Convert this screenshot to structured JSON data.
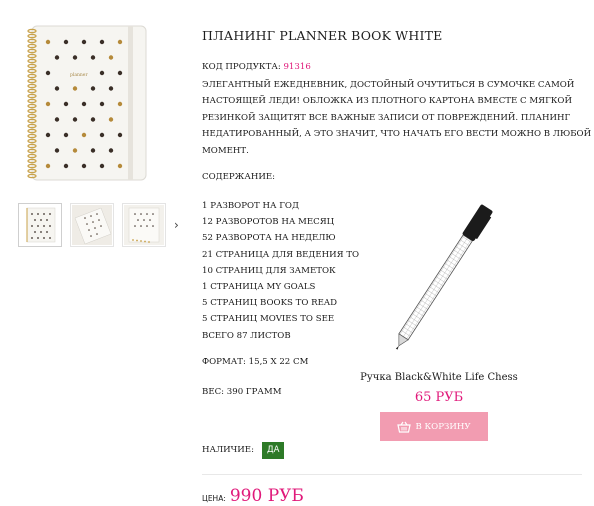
{
  "product": {
    "title": "ПЛАНИНГ PLANNER BOOK WHITE",
    "code_label": "КОД ПРОДУКТА:",
    "code_value": "91316",
    "description_lines": [
      "ЭЛЕГАНТНЫЙ ЕЖЕДНЕВНИК, ДОСТОЙНЫЙ ОЧУТИТЬСЯ В СУМОЧКЕ САМОЙ",
      "НАСТОЯЩЕЙ ЛЕДИ! ОБЛОЖКА ИЗ ПЛОТНОГО КАРТОНА ВМЕСТЕ С МЯГКОЙ",
      "РЕЗИНКОЙ ЗАЩИТЯТ ВСЕ ВАЖНЫЕ ЗАПИСИ ОТ ПОВРЕЖДЕНИЙ. ПЛАНИНГ",
      "НЕДАТИРОВАННЫЙ, А ЭТО ЗНАЧИТ, ЧТО НАЧАТЬ ЕГО ВЕСТИ МОЖНО В ЛЮБОЙ",
      "МОМЕНТ."
    ],
    "content_label": "СОДЕРЖАНИЕ:",
    "content_items": [
      "1 РАЗВОРОТ НА ГОД",
      "12 РАЗВОРОТОВ НА МЕСЯЦ",
      "52 РАЗВОРОТА НА НЕДЕЛЮ",
      "21 СТРАНИЦА ДЛЯ ВЕДЕНИЯ ТО",
      "10 СТРАНИЦ ДЛЯ ЗАМЕТОК",
      "1 СТРАНИЦА MY GOALS",
      "5 СТРАНИЦ BOOKS TO READ",
      "5 СТРАНИЦ MOVIES TO SEE",
      "ВСЕГО 87 ЛИСТОВ"
    ],
    "format": "ФОРМАТ: 15,5 Х 22 СМ",
    "weight": "ВЕС: 390 ГРАММ",
    "availability_label": "НАЛИЧИЕ:",
    "availability_value": "ДА",
    "price_label": "ЦЕНА:",
    "price_value": "990 РУБ",
    "cover_text": "planner"
  },
  "gallery": {
    "next_arrow": "›"
  },
  "related": {
    "name": "Ручка Black&White Life Chess",
    "price": "65 РУБ",
    "button_label": "В КОРЗИНУ"
  },
  "colors": {
    "accent": "#e0197a",
    "button": "#f29cb1",
    "badge": "#2d7a27"
  },
  "icons": {
    "cart": "shopping-basket-icon",
    "arrow": "chevron-right-icon"
  }
}
